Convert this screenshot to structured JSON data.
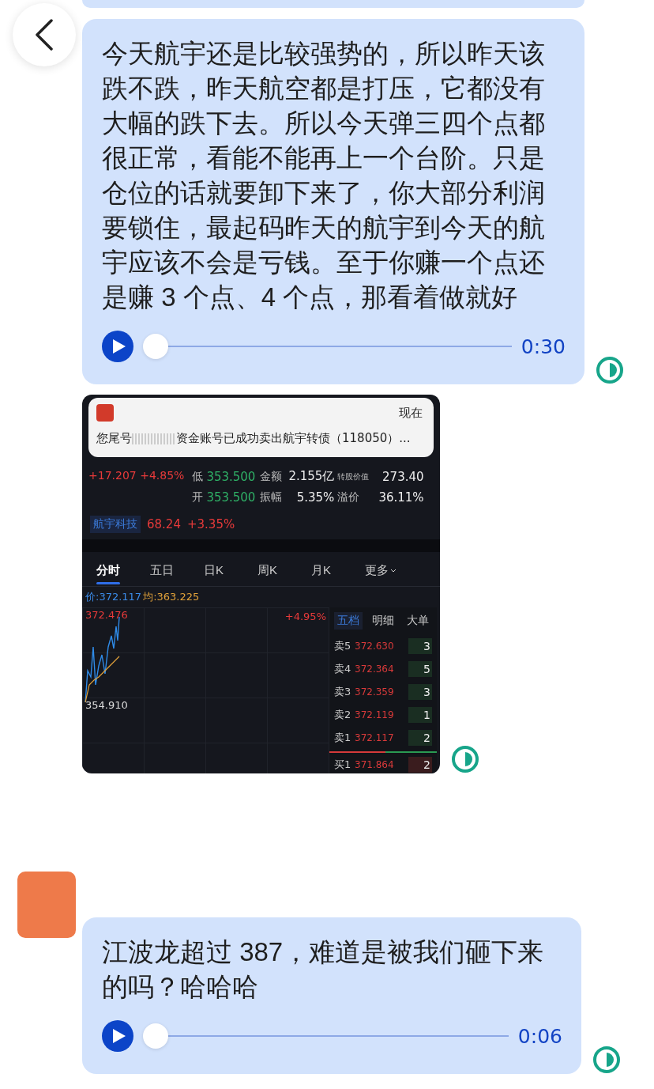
{
  "messages": [
    {
      "kind": "partial"
    },
    {
      "kind": "voice",
      "text": "今天航宇还是比较强势的，所以昨天该跌不跌，昨天航空都是打压，它都没有大幅的跌下去。所以今天弹三四个点都很正常，看能不能再上一个台阶。只是仓位的话就要卸下来了，你大部分利润要锁住，最起码昨天的航宇到今天的航宇应该不会是亏钱。至于你赚一个点还是赚 3 个点、4 个点，那看着做就好",
      "duration": "0:30",
      "level": 0
    },
    {
      "kind": "image",
      "screenshot": {
        "notification": {
          "time": "现在",
          "text_start": "您尾号",
          "text_end": "资金账号已成功卖出航宇转债（118050）..."
        },
        "change": "+17.207 +4.85%",
        "stats": [
          {
            "label": "低",
            "value": "353.500",
            "label_2": "金额",
            "value_2": "2.155亿",
            "label_3": "转股价值",
            "value_3": "273.40"
          },
          {
            "label": "开",
            "value": "353.500",
            "label_2": "振幅",
            "value_2": "5.35%",
            "label_3": "溢价",
            "value_3": "36.11%"
          }
        ],
        "stock": {
          "name": "航宇科技",
          "price": "68.24",
          "change": "+3.35%"
        },
        "tabs": [
          {
            "label": "分时",
            "selected": true
          },
          {
            "label": "五日",
            "selected": false
          },
          {
            "label": "日K",
            "selected": false
          },
          {
            "label": "周K",
            "selected": false
          },
          {
            "label": "月K",
            "selected": false
          },
          {
            "label": "更多",
            "selected": false
          }
        ],
        "legend": {
          "price": "价:372.117",
          "average": "均:363.225"
        },
        "chart": {
          "high": "372.476",
          "low": "354.910",
          "percent": "+4.95%"
        },
        "book_tabs": [
          {
            "label": "五档",
            "selected": true
          },
          {
            "label": "明细",
            "selected": false
          },
          {
            "label": "大单",
            "selected": false
          }
        ],
        "book": [
          {
            "kind": "sell",
            "label": "卖5",
            "price": "372.630",
            "volume": "3"
          },
          {
            "kind": "sell",
            "label": "卖4",
            "price": "372.364",
            "volume": "5"
          },
          {
            "kind": "sell",
            "label": "卖3",
            "price": "372.359",
            "volume": "3"
          },
          {
            "kind": "sell",
            "label": "卖2",
            "price": "372.119",
            "volume": "1"
          },
          {
            "kind": "sell",
            "label": "卖1",
            "price": "372.117",
            "volume": "2"
          },
          {
            "kind": "buy",
            "label": "买1",
            "price": "371.864",
            "volume": "2"
          }
        ]
      }
    },
    {
      "kind": "voice",
      "avatar": true,
      "text": "江波龙超过 387，难道是被我们砸下来的吗？哈哈哈",
      "duration": "0:06",
      "level": 0
    }
  ]
}
